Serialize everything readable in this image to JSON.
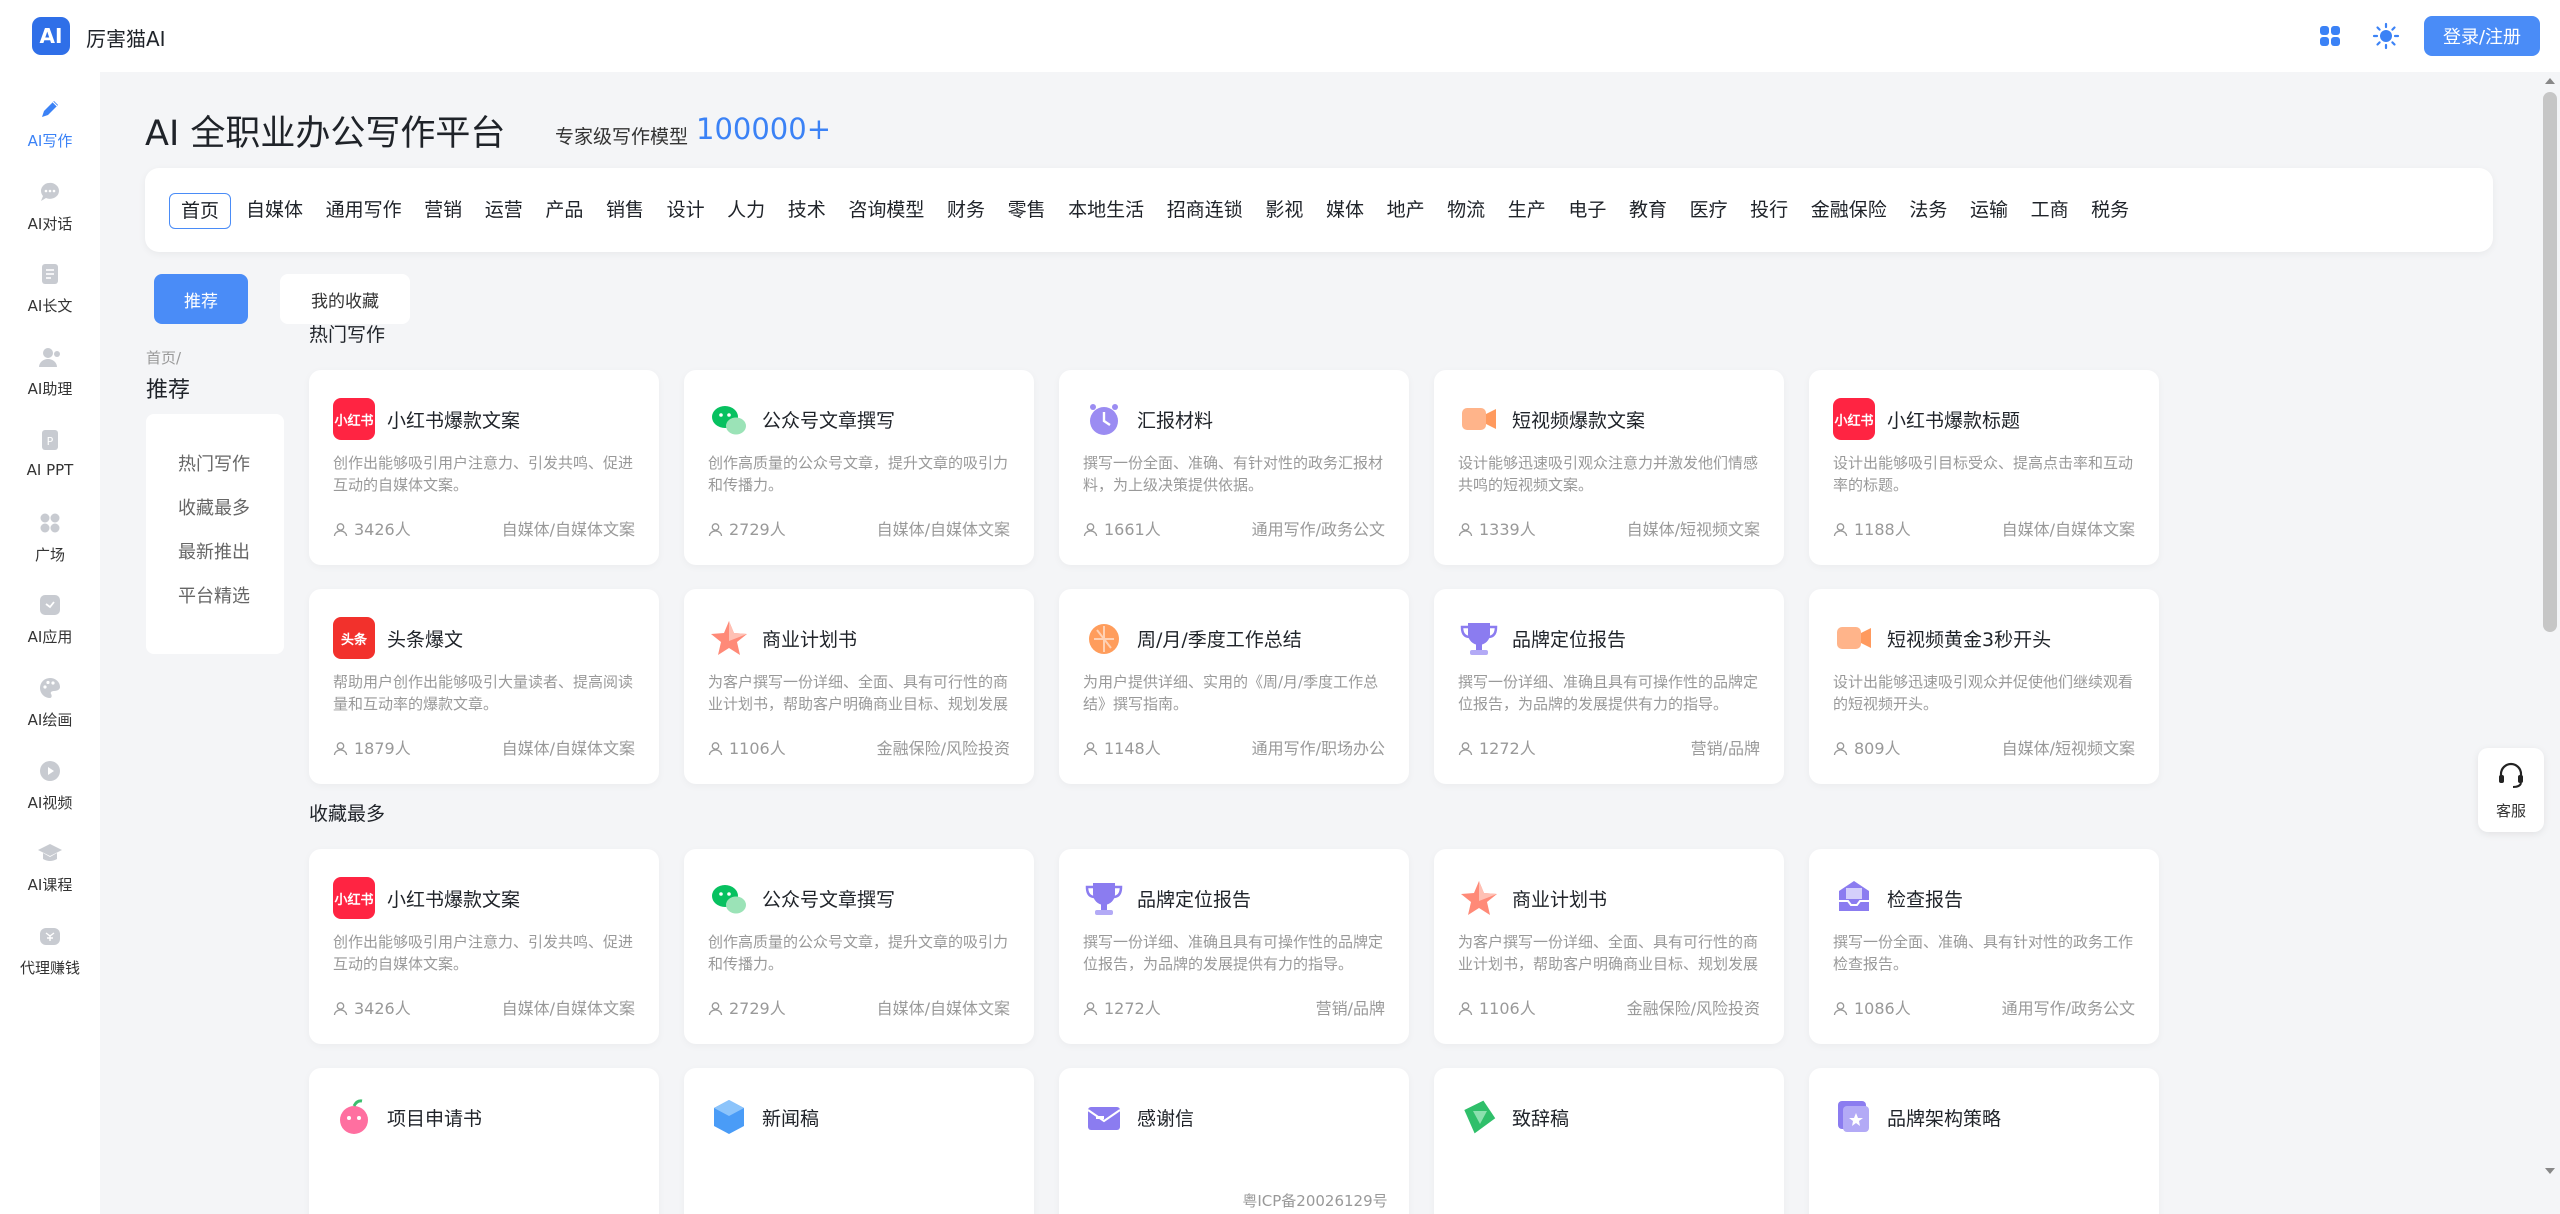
{
  "header": {
    "logo_text": "AI",
    "app_name": "厉害猫AI",
    "login_label": "登录/注册",
    "grid_icon": "grid-icon",
    "theme_icon": "sun-icon"
  },
  "sidebar": {
    "items": [
      {
        "label": "AI写作",
        "icon": "pen-icon"
      },
      {
        "label": "AI对话",
        "icon": "chat-icon"
      },
      {
        "label": "AI长文",
        "icon": "document-icon"
      },
      {
        "label": "AI助理",
        "icon": "assistant-icon"
      },
      {
        "label": "AI PPT",
        "icon": "ppt-icon"
      },
      {
        "label": "广场",
        "icon": "square-grid-icon"
      },
      {
        "label": "AI应用",
        "icon": "app-icon"
      },
      {
        "label": "AI绘画",
        "icon": "palette-icon"
      },
      {
        "label": "AI视频",
        "icon": "video-icon"
      },
      {
        "label": "AI课程",
        "icon": "graduation-icon"
      },
      {
        "label": "代理赚钱",
        "icon": "money-icon"
      }
    ]
  },
  "main": {
    "title": "AI 全职业办公写作平台",
    "subtitle": "专家级写作模型",
    "count": "100000+"
  },
  "categories": [
    "首页",
    "自媒体",
    "通用写作",
    "营销",
    "运营",
    "产品",
    "销售",
    "设计",
    "人力",
    "技术",
    "咨询模型",
    "财务",
    "零售",
    "本地生活",
    "招商连锁",
    "影视",
    "媒体",
    "地产",
    "物流",
    "生产",
    "电子",
    "教育",
    "医疗",
    "投行",
    "金融保险",
    "法务",
    "运输",
    "工商",
    "税务"
  ],
  "tabs": {
    "recommend": "推荐",
    "favorites": "我的收藏"
  },
  "breadcrumb": "首页/",
  "current_title": "推荐",
  "subnav": [
    "热门写作",
    "收藏最多",
    "最新推出",
    "平台精选"
  ],
  "sections": [
    {
      "title": "热门写作",
      "cards": [
        {
          "title": "小红书爆款文案",
          "desc": "创作出能够吸引用户注意力、引发共鸣、促进互动的自媒体文案。",
          "users": "3426人",
          "tag": "自媒体/自媒体文案",
          "icon": "xiaohongshu-icon",
          "icon_text": "小红书",
          "color": "#ff2442"
        },
        {
          "title": "公众号文章撰写",
          "desc": "创作高质量的公众号文章，提升文章的吸引力和传播力。",
          "users": "2729人",
          "tag": "自媒体/自媒体文案",
          "icon": "wechat-icon",
          "icon_text": "",
          "color": "#07c160"
        },
        {
          "title": "汇报材料",
          "desc": "撰写一份全面、准确、有针对性的政务汇报材料，为上级决策提供依据。",
          "users": "1661人",
          "tag": "通用写作/政务公文",
          "icon": "clock-icon",
          "icon_text": "",
          "color": "#9b8cf2"
        },
        {
          "title": "短视频爆款文案",
          "desc": "设计能够迅速吸引观众注意力并激发他们情感共鸣的短视频文案。",
          "users": "1339人",
          "tag": "自媒体/短视频文案",
          "icon": "camera-icon",
          "icon_text": "",
          "color": "#ffb48a"
        },
        {
          "title": "小红书爆款标题",
          "desc": "设计出能够吸引目标受众、提高点击率和互动率的标题。",
          "users": "1188人",
          "tag": "自媒体/自媒体文案",
          "icon": "xiaohongshu-icon",
          "icon_text": "小红书",
          "color": "#ff2442"
        },
        {
          "title": "头条爆文",
          "desc": "帮助用户创作出能够吸引大量读者、提高阅读量和互动率的爆款文章。",
          "users": "1879人",
          "tag": "自媒体/自媒体文案",
          "icon": "toutiao-icon",
          "icon_text": "头条",
          "color": "#f2312c"
        },
        {
          "title": "商业计划书",
          "desc": "为客户撰写一份详细、全面、具有可行性的商业计划书，帮助客户明确商业目标、规划发展路径。",
          "users": "1106人",
          "tag": "金融保险/风险投资",
          "icon": "star-icon",
          "icon_text": "",
          "color": "#ff8a78"
        },
        {
          "title": "周/月/季度工作总结",
          "desc": "为用户提供详细、实用的《周/月/季度工作总结》撰写指南。",
          "users": "1148人",
          "tag": "通用写作/职场办公",
          "icon": "calendar-icon",
          "icon_text": "",
          "color": "#ff9d5c"
        },
        {
          "title": "品牌定位报告",
          "desc": "撰写一份详细、准确且具有可操作性的品牌定位报告，为品牌的发展提供有力的指导。",
          "users": "1272人",
          "tag": "营销/品牌",
          "icon": "trophy-icon",
          "icon_text": "",
          "color": "#8b7cf0"
        },
        {
          "title": "短视频黄金3秒开头",
          "desc": "设计出能够迅速吸引观众并促使他们继续观看的短视频开头。",
          "users": "809人",
          "tag": "自媒体/短视频文案",
          "icon": "camera-icon",
          "icon_text": "",
          "color": "#ffb48a"
        }
      ]
    },
    {
      "title": "收藏最多",
      "cards": [
        {
          "title": "小红书爆款文案",
          "desc": "创作出能够吸引用户注意力、引发共鸣、促进互动的自媒体文案。",
          "users": "3426人",
          "tag": "自媒体/自媒体文案",
          "icon": "xiaohongshu-icon",
          "icon_text": "小红书",
          "color": "#ff2442"
        },
        {
          "title": "公众号文章撰写",
          "desc": "创作高质量的公众号文章，提升文章的吸引力和传播力。",
          "users": "2729人",
          "tag": "自媒体/自媒体文案",
          "icon": "wechat-icon",
          "icon_text": "",
          "color": "#07c160"
        },
        {
          "title": "品牌定位报告",
          "desc": "撰写一份详细、准确且具有可操作性的品牌定位报告，为品牌的发展提供有力的指导。",
          "users": "1272人",
          "tag": "营销/品牌",
          "icon": "trophy-icon",
          "icon_text": "",
          "color": "#8b7cf0"
        },
        {
          "title": "商业计划书",
          "desc": "为客户撰写一份详细、全面、具有可行性的商业计划书，帮助客户明确商业目标、规划发展路径。",
          "users": "1106人",
          "tag": "金融保险/风险投资",
          "icon": "star-icon",
          "icon_text": "",
          "color": "#ff8a78"
        },
        {
          "title": "检查报告",
          "desc": "撰写一份全面、准确、具有针对性的政务工作检查报告。",
          "users": "1086人",
          "tag": "通用写作/政务公文",
          "icon": "inbox-icon",
          "icon_text": "",
          "color": "#8b7cf0"
        },
        {
          "title": "项目申请书",
          "desc": "",
          "users": "",
          "tag": "",
          "icon": "apple-icon",
          "icon_text": "",
          "color": "#ff6fa0"
        },
        {
          "title": "新闻稿",
          "desc": "",
          "users": "",
          "tag": "",
          "icon": "hexagon-icon",
          "icon_text": "",
          "color": "#4a9cf7"
        },
        {
          "title": "感谢信",
          "desc": "",
          "users": "",
          "tag": "",
          "icon": "envelope-icon",
          "icon_text": "",
          "color": "#8b7cf0"
        },
        {
          "title": "致辞稿",
          "desc": "",
          "users": "",
          "tag": "",
          "icon": "diamond-icon",
          "icon_text": "",
          "color": "#2fbf6a"
        },
        {
          "title": "品牌架构策略",
          "desc": "",
          "users": "",
          "tag": "",
          "icon": "frame-icon",
          "icon_text": "",
          "color": "#8b7cf0"
        }
      ]
    }
  ],
  "service": {
    "label": "客服",
    "icon": "headset-icon"
  },
  "footer": "粤ICP备20026129号",
  "colors": {
    "accent": "#4a8cf7",
    "brand": "#2f6fe8"
  }
}
